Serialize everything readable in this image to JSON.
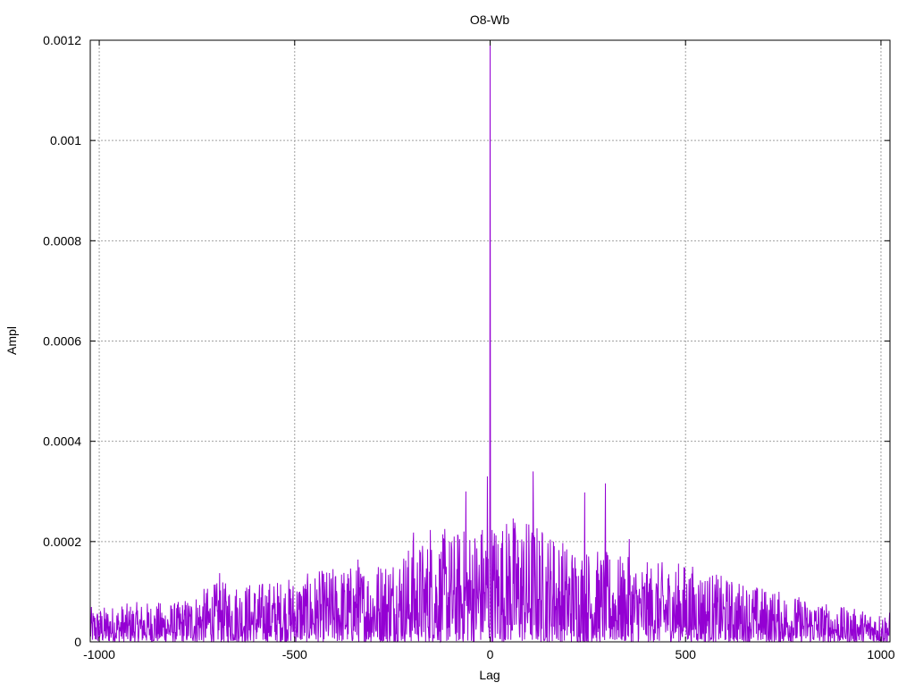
{
  "chart_data": {
    "type": "line",
    "title": "O8-Wb",
    "xlabel": "Lag",
    "ylabel": "Ampl",
    "xlim": [
      -1023,
      1023
    ],
    "ylim": [
      0,
      0.0012
    ],
    "xticks": [
      "-1000",
      "-500",
      "0",
      "500",
      "1000"
    ],
    "xtick_values": [
      -1000,
      -500,
      0,
      500,
      1000
    ],
    "yticks": [
      "0",
      "0.0002",
      "0.0004",
      "0.0006",
      "0.0008",
      "0.001",
      "0.0012"
    ],
    "ytick_values": [
      0,
      0.0002,
      0.0004,
      0.0006,
      0.0008,
      0.001,
      0.0012
    ],
    "grid": true,
    "legend": "none",
    "series_color": "#9400d3",
    "peaks": [
      {
        "lag": 0,
        "ampl": 0.00119
      },
      {
        "lag": -7,
        "ampl": 0.00033
      },
      {
        "lag": -62,
        "ampl": 0.0003
      },
      {
        "lag": 110,
        "ampl": 0.00034
      },
      {
        "lag": 295,
        "ampl": 0.000316
      },
      {
        "lag": 242,
        "ampl": 0.000298
      },
      {
        "lag": 59,
        "ampl": 0.000246
      },
      {
        "lag": 48,
        "ampl": 0.000216
      },
      {
        "lag": -196,
        "ampl": 0.000218
      },
      {
        "lag": -153,
        "ampl": 0.000223
      },
      {
        "lag": -116,
        "ampl": 0.000225
      },
      {
        "lag": 356,
        "ampl": 0.000205
      },
      {
        "lag": 162,
        "ampl": 0.0002
      },
      {
        "lag": -338,
        "ampl": 0.000164
      },
      {
        "lag": -692,
        "ampl": 0.000137
      }
    ],
    "envelope": {
      "lags": [
        -1000,
        -900,
        -800,
        -700,
        -600,
        -500,
        -400,
        -300,
        -200,
        -100,
        0,
        100,
        200,
        300,
        400,
        500,
        600,
        700,
        800,
        900,
        1000
      ],
      "max_ampl": [
        7e-05,
        8e-05,
        8e-05,
        0.00012,
        0.00012,
        0.00013,
        0.00015,
        0.00016,
        0.0002,
        0.00022,
        0.00025,
        0.00025,
        0.0002,
        0.00018,
        0.00016,
        0.00016,
        0.00013,
        0.00011,
        9e-05,
        7e-05,
        6e-05
      ]
    }
  }
}
